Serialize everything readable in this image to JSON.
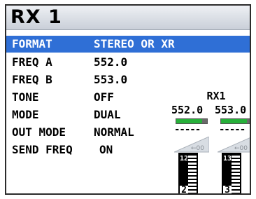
{
  "window": {
    "title": "RX 1"
  },
  "settings": [
    {
      "label": "FORMAT",
      "value": "STEREO OR XR",
      "selected": true
    },
    {
      "label": "FREQ A",
      "value": "552.0",
      "selected": false
    },
    {
      "label": "FREQ B",
      "value": "553.0",
      "selected": false
    },
    {
      "label": "TONE",
      "value": "OFF",
      "selected": false
    },
    {
      "label": "MODE",
      "value": "DUAL",
      "selected": false
    },
    {
      "label": "OUT MODE",
      "value": "NORMAL",
      "selected": false
    },
    {
      "label": "SEND FREQ",
      "value": "ON",
      "selected": false
    }
  ],
  "status_panel": {
    "title": "RX1",
    "channels": [
      {
        "freq": "552.0",
        "signal_level": 0.85,
        "dashes": "-----",
        "ramp_label": "←00",
        "meter_top": "12",
        "meter_bottom": "2"
      },
      {
        "freq": "553.0",
        "signal_level": 0.85,
        "dashes": "-----",
        "ramp_label": "←00",
        "meter_top": "13",
        "meter_bottom": "3"
      }
    ]
  },
  "colors": {
    "selection": "#2f6fd6",
    "signal": "#27b03a",
    "titlebar": "#d6dbe3"
  }
}
